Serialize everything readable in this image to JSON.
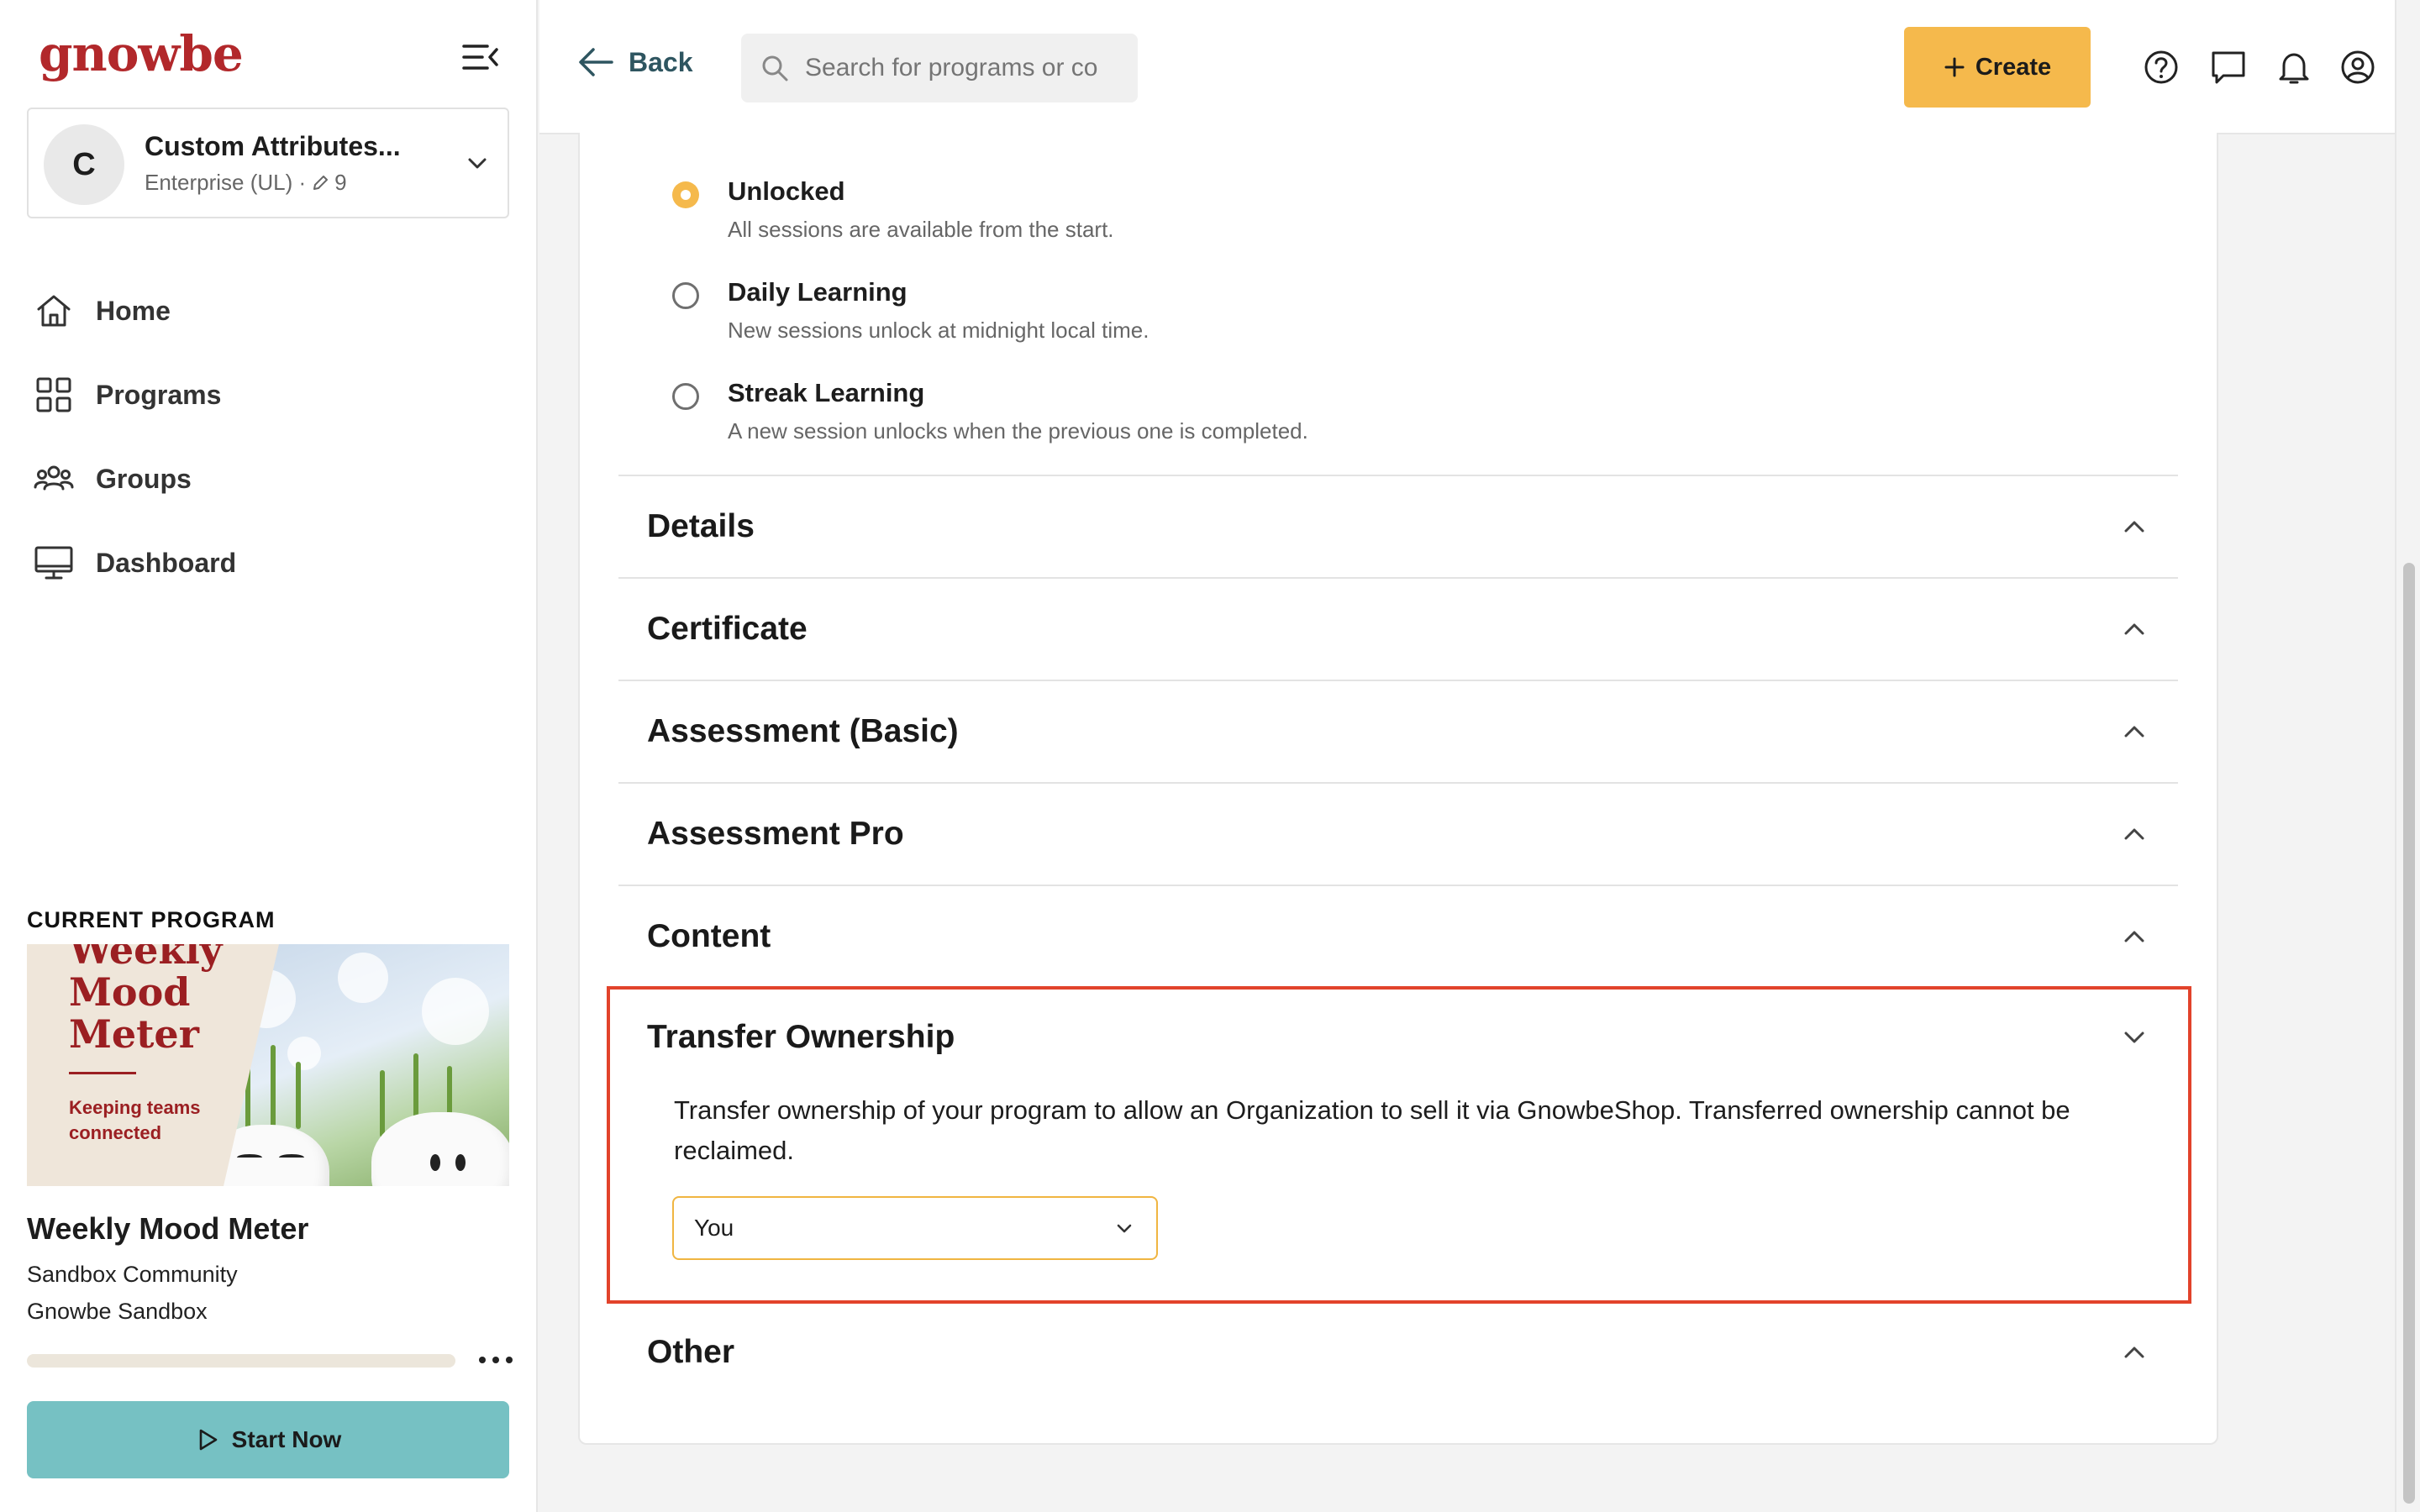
{
  "sidebar": {
    "logo": "gnowbe",
    "org": {
      "initial": "C",
      "name": "Custom Attributes...",
      "subtitle": "Enterprise (UL) ·",
      "edit_count": "9"
    },
    "nav": [
      {
        "label": "Home",
        "icon": "home-icon"
      },
      {
        "label": "Programs",
        "icon": "grid-icon"
      },
      {
        "label": "Groups",
        "icon": "users-icon"
      },
      {
        "label": "Dashboard",
        "icon": "monitor-icon"
      }
    ],
    "current_program": {
      "section_label": "CURRENT PROGRAM",
      "thumb_title": "Weekly Mood Meter",
      "thumb_tagline": "Keeping teams connected",
      "title": "Weekly Mood Meter",
      "community": "Sandbox Community",
      "org": "Gnowbe Sandbox",
      "progress": 0.0,
      "start_label": "Start Now"
    }
  },
  "topbar": {
    "back_label": "Back",
    "search_placeholder": "Search for programs or co",
    "create_label": "Create",
    "icons": [
      "help-icon",
      "chat-icon",
      "bell-icon",
      "profile-icon"
    ]
  },
  "unlock_options": [
    {
      "title": "Unlocked",
      "desc": "All sessions are available from the start.",
      "checked": true
    },
    {
      "title": "Daily Learning",
      "desc": "New sessions unlock at midnight local time.",
      "checked": false
    },
    {
      "title": "Streak Learning",
      "desc": "A new session unlocks when the previous one is completed.",
      "checked": false
    }
  ],
  "sections": {
    "details": "Details",
    "certificate": "Certificate",
    "assessment_basic": "Assessment (Basic)",
    "assessment_pro": "Assessment Pro",
    "content": "Content",
    "transfer": "Transfer Ownership",
    "other": "Other"
  },
  "transfer": {
    "description": "Transfer ownership of your program to allow an Organization to sell it via GnowbeShop. Transferred ownership cannot be reclaimed.",
    "selected_owner": "You"
  },
  "colors": {
    "brand": "#b2282b",
    "accent": "#f5b94c",
    "start": "#76c1c3",
    "highlight": "#e2432b"
  }
}
